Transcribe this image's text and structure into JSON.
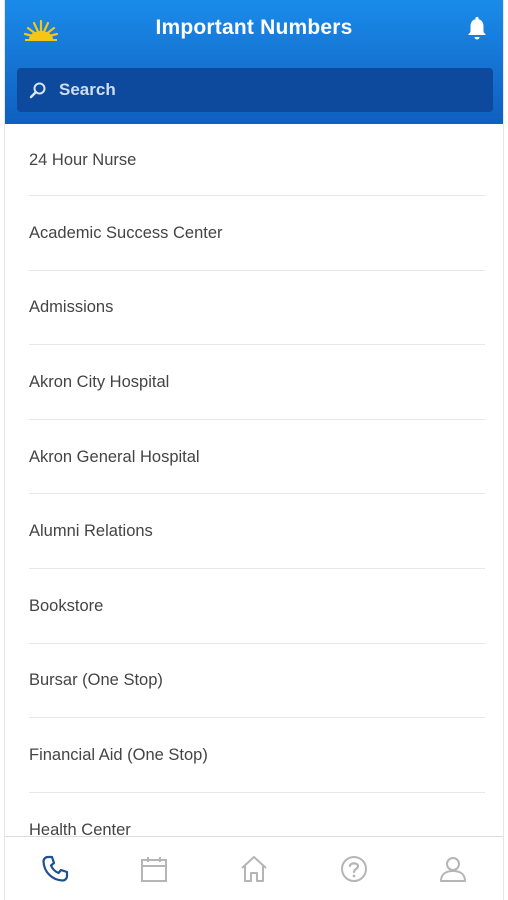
{
  "header": {
    "title": "Important Numbers",
    "logo_icon": "sunburst-logo",
    "bell_icon": "bell-icon"
  },
  "search": {
    "placeholder": "Search",
    "icon": "search-icon"
  },
  "list": {
    "items": [
      {
        "label": "24 Hour Nurse"
      },
      {
        "label": "Academic Success Center"
      },
      {
        "label": "Admissions"
      },
      {
        "label": "Akron City Hospital"
      },
      {
        "label": "Akron General Hospital"
      },
      {
        "label": "Alumni Relations"
      },
      {
        "label": "Bookstore"
      },
      {
        "label": "Bursar (One Stop)"
      },
      {
        "label": "Financial Aid (One Stop)"
      },
      {
        "label": "Health Center"
      }
    ]
  },
  "tabbar": {
    "tabs": [
      {
        "icon": "phone-icon",
        "active": true
      },
      {
        "icon": "calendar-icon",
        "active": false
      },
      {
        "icon": "home-icon",
        "active": false
      },
      {
        "icon": "help-icon",
        "active": false
      },
      {
        "icon": "profile-icon",
        "active": false
      }
    ]
  },
  "colors": {
    "header_top": "#1a8bea",
    "header_bottom": "#0f5fbf",
    "search_bg": "#0d4a9e",
    "active_tab": "#1d4f91",
    "inactive_tab": "#b5b5b5",
    "logo_gold": "#f5c518"
  }
}
